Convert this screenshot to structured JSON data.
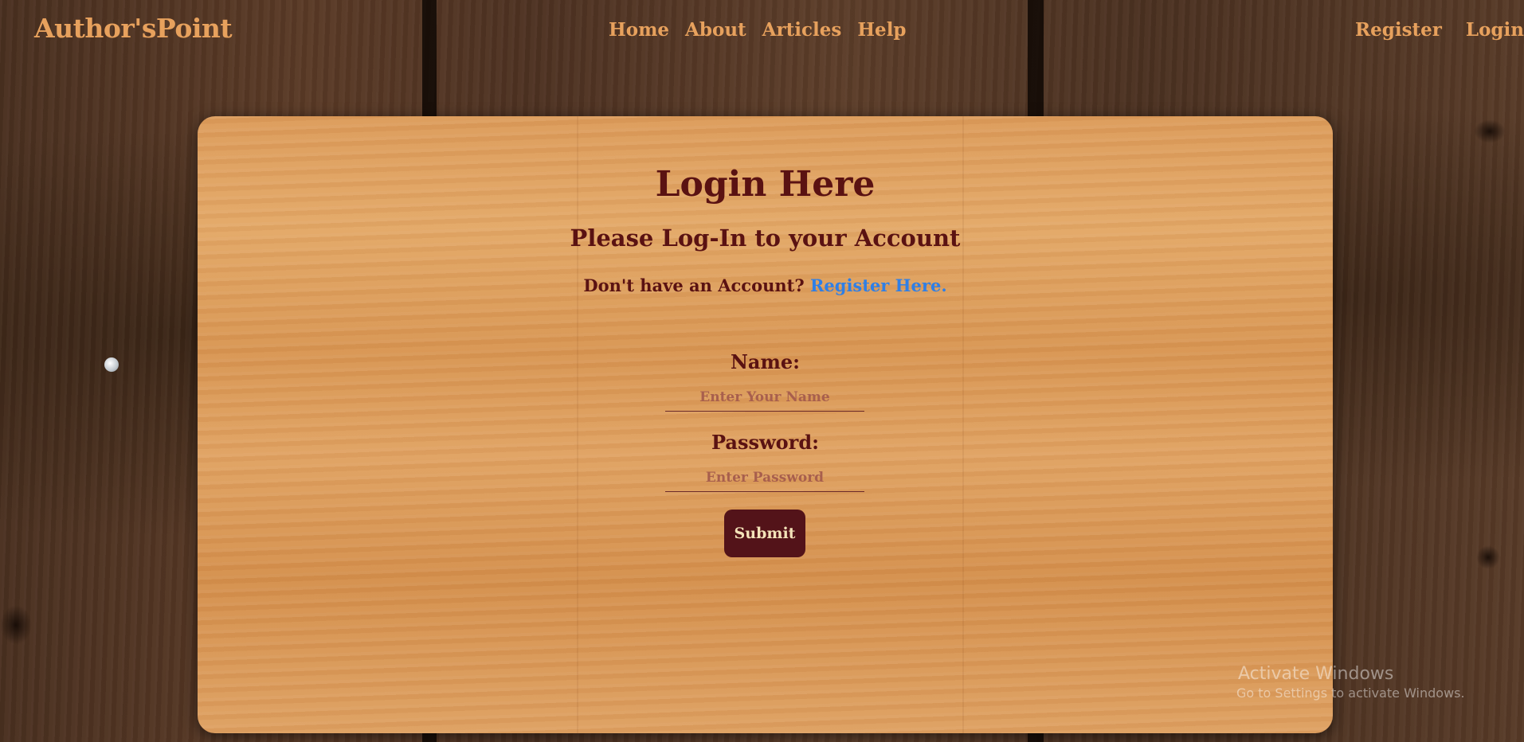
{
  "navbar": {
    "brand": "Author'sPoint",
    "center_links": [
      "Home",
      "About",
      "Articles",
      "Help"
    ],
    "right_links": [
      "Register",
      "Login"
    ]
  },
  "login": {
    "title": "Login Here",
    "subtitle": "Please Log-In to your Account",
    "no_account_text": "Don't have an Account?",
    "register_link": "Register Here.",
    "name_label": "Name:",
    "name_placeholder": "Enter Your Name",
    "password_label": "Password:",
    "password_placeholder": "Enter Password",
    "submit_label": "Submit"
  },
  "watermark": {
    "title": "Activate Windows",
    "subtitle": "Go to Settings to activate Windows."
  },
  "colors": {
    "accent": "#e7a15d",
    "heading": "#5a1212",
    "link": "#2f7fe6",
    "button_bg": "#531319",
    "button_text": "#f3e3b9"
  }
}
